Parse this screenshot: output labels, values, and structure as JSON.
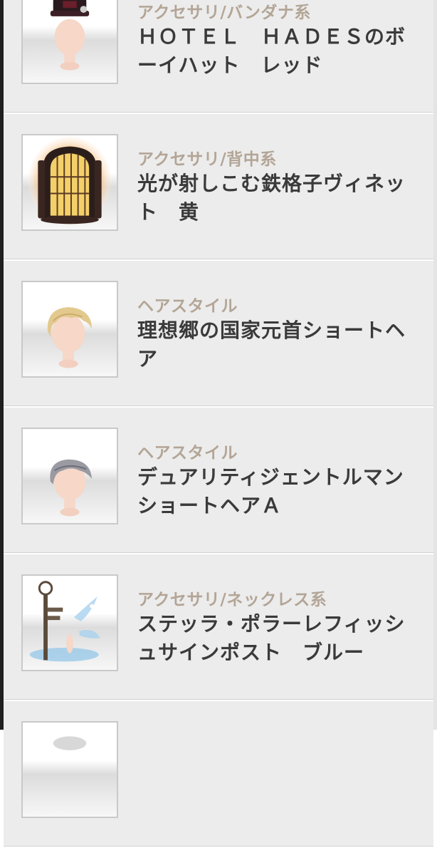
{
  "items": [
    {
      "category": "アクセサリ/バンダナ系",
      "name": "ＨＯＴＥＬ　ＨＡＤＥＳのボーイハット　レッド",
      "icon": "boy-hat-thumbnail-icon"
    },
    {
      "category": "アクセサリ/背中系",
      "name": "光が射しこむ鉄格子ヴィネット　黄",
      "icon": "iron-lattice-vignette-thumbnail-icon"
    },
    {
      "category": "ヘアスタイル",
      "name": "理想郷の国家元首ショートヘア",
      "icon": "blonde-short-hair-thumbnail-icon"
    },
    {
      "category": "ヘアスタイル",
      "name": "デュアリティジェントルマンショートヘアＡ",
      "icon": "silver-short-hair-thumbnail-icon"
    },
    {
      "category": "アクセサリ/ネックレス系",
      "name": "ステッラ・ポラーレフィッシュサインポスト　ブルー",
      "icon": "fish-signpost-thumbnail-icon"
    },
    {
      "category": "",
      "name": "",
      "icon": "hair-thumbnail-icon"
    }
  ],
  "colors": {
    "background": "#ececec",
    "category_text": "#b3a596",
    "name_text": "#3a3a3a",
    "divider": "#d2d2d2"
  }
}
